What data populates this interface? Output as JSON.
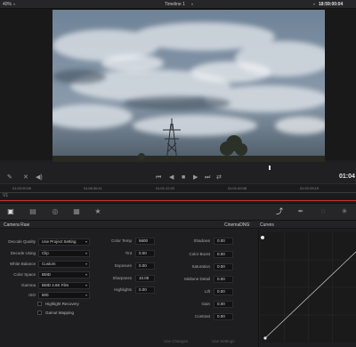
{
  "topbar": {
    "zoom": "40%",
    "timeline": "Timeline 1",
    "timecode": "18:59:00:04"
  },
  "transport": {
    "timecode": "01:04"
  },
  "ruler": {
    "ticks": [
      "01:00:00:00",
      "01:00:36:11",
      "01:01:12:22",
      "01:01:49:08",
      "01:02:25:19"
    ]
  },
  "panels": {
    "left_title": "Camera Raw",
    "mid_title": "CinemaDNG",
    "right_title": "Curves"
  },
  "camera_raw": {
    "settings": [
      {
        "label": "Decode Quality",
        "value": "Use Project Setting"
      },
      {
        "label": "Decode Using",
        "value": "Clip"
      },
      {
        "label": "White Balance",
        "value": "Custom"
      },
      {
        "label": "Color Space",
        "value": "BMD"
      },
      {
        "label": "Gamma",
        "value": "BMD 4.6K Film"
      },
      {
        "label": "ISO",
        "value": "800"
      }
    ],
    "checkboxes": [
      "Highlight Recovery",
      "Gamut Mapping"
    ]
  },
  "adjust_mid": [
    {
      "label": "Color Temp",
      "value": "5600"
    },
    {
      "label": "Tint",
      "value": "0.00"
    },
    {
      "label": "Exposure",
      "value": "0.00"
    },
    {
      "label": "Sharpness",
      "value": "10.00"
    },
    {
      "label": "Highlights",
      "value": "0.00"
    }
  ],
  "adjust_right": [
    {
      "label": "Shadows",
      "value": "0.00"
    },
    {
      "label": "Color Boost",
      "value": "0.00"
    },
    {
      "label": "Saturation",
      "value": "0.00"
    },
    {
      "label": "Midtone Detail",
      "value": "0.00"
    },
    {
      "label": "Lift",
      "value": "0.00"
    },
    {
      "label": "Gain",
      "value": "0.00"
    },
    {
      "label": "Contrast",
      "value": "0.00"
    }
  ],
  "footer": {
    "use_changes": "Use Changes",
    "use_settings": "Use Settings"
  },
  "colors": {
    "accent": "#c8352f",
    "panel": "#1e1e20",
    "sky": "#5d7184"
  }
}
